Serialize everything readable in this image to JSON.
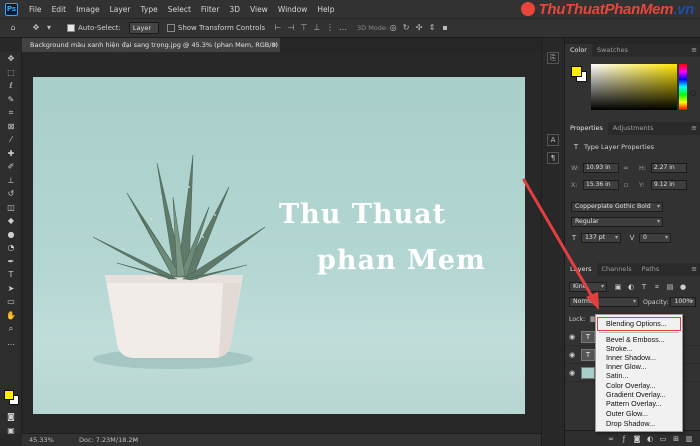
{
  "menu": {
    "app_icon": "Ps",
    "items": [
      "File",
      "Edit",
      "Image",
      "Layer",
      "Type",
      "Select",
      "Filter",
      "3D",
      "View",
      "Window",
      "Help"
    ]
  },
  "brand": {
    "part1": "ThuThuat",
    "part2": "PhanMem",
    "part3": ".vn"
  },
  "options": {
    "auto_select_label": "Auto-Select:",
    "auto_select_value": "Layer",
    "transform_controls_label": "Show Transform Controls",
    "mode_3d_label": "3D Mode:"
  },
  "document": {
    "tab_title": "Background màu xanh hiện đại sang trọng.jpg @ 45.3% (phan Mem, RGB/8) *",
    "close": "×",
    "text_line1": "Thu Thuat",
    "text_line2": "phan Mem"
  },
  "status": {
    "zoom": "45.33%",
    "doc_size": "Doc: 7.23M/18.2M",
    "arrow": ">"
  },
  "color_panel": {
    "tabs": [
      "Color",
      "Swatches"
    ],
    "foreground": "#ffee00",
    "background": "#ffffff"
  },
  "properties_panel": {
    "tabs": [
      "Properties",
      "Adjustments"
    ],
    "section_title": "Type Layer Properties",
    "w_label": "W:",
    "w_value": "10.93 in",
    "h_label": "H:",
    "h_value": "2.27 in",
    "x_label": "X:",
    "x_value": "15.36 in",
    "y_label": "Y:",
    "y_value": "9.12 in",
    "font_family": "Copperplate Gothic Bold",
    "font_style": "Regular",
    "font_size": "137 pt",
    "tracking": "0"
  },
  "layers_panel": {
    "tabs": [
      "Layers",
      "Channels",
      "Paths"
    ],
    "filter_kind": "Kind",
    "blend_mode": "Normal",
    "opacity_label": "Opacity:",
    "opacity_value": "100%",
    "lock_label": "Lock:",
    "layer_thumbs": [
      "T",
      "T",
      ""
    ]
  },
  "context_menu": {
    "items": [
      "Blending Options...",
      "Bevel & Emboss...",
      "Stroke...",
      "Inner Shadow...",
      "Inner Glow...",
      "Satin...",
      "Color Overlay...",
      "Gradient Overlay...",
      "Pattern Overlay...",
      "Outer Glow...",
      "Drop Shadow..."
    ],
    "highlighted": "Blending Options..."
  },
  "annotation": {
    "arrow_color": "#e23f3f"
  }
}
